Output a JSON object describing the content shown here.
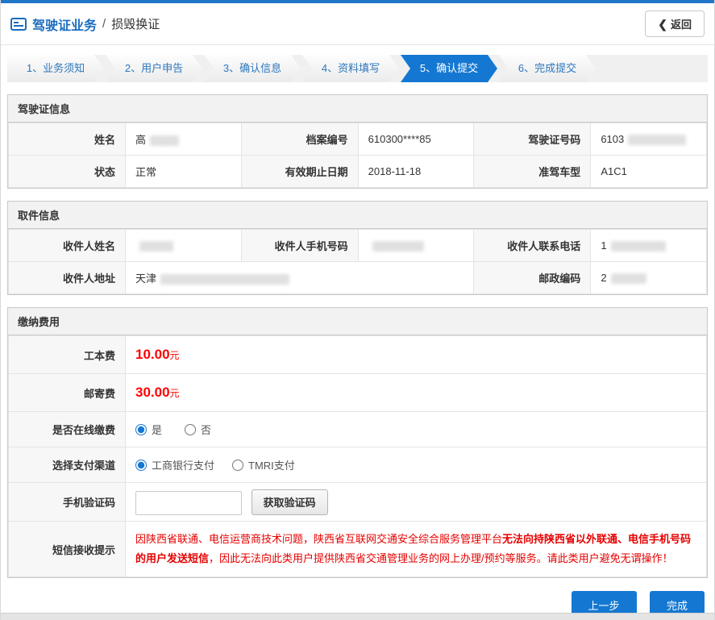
{
  "header": {
    "title": "驾驶证业务",
    "divider": "/",
    "subtitle": "损毁换证",
    "back_icon": "❮",
    "back_label": "返回"
  },
  "steps": {
    "s1": "1、业务须知",
    "s2": "2、用户申告",
    "s3": "3、确认信息",
    "s4": "4、资料填写",
    "s5": "5、确认提交",
    "s6": "6、完成提交"
  },
  "license": {
    "title": "驾驶证信息",
    "name_label": "姓名",
    "name_value": "高",
    "file_label": "档案编号",
    "file_value": "610300****85",
    "number_label": "驾驶证号码",
    "number_value": "6103",
    "status_label": "状态",
    "status_value": "正常",
    "expiry_label": "有效期止日期",
    "expiry_value": "2018-11-18",
    "vehicle_label": "准驾车型",
    "vehicle_value": "A1C1"
  },
  "pickup": {
    "title": "取件信息",
    "name_label": "收件人姓名",
    "mobile_label": "收件人手机号码",
    "phone_label": "收件人联系电话",
    "phone_value": "1",
    "address_label": "收件人地址",
    "address_value": "天津",
    "postal_label": "邮政编码",
    "postal_value": "2"
  },
  "fees": {
    "title": "缴纳费用",
    "production_label": "工本费",
    "production_value": "10.00",
    "production_unit": "元",
    "postage_label": "邮寄费",
    "postage_value": "30.00",
    "postage_unit": "元",
    "online_label": "是否在线缴费",
    "online_yes": "是",
    "online_no": "否",
    "channel_label": "选择支付渠道",
    "channel_icbc": "工商银行支付",
    "channel_tmri": "TMRI支付",
    "code_label": "手机验证码",
    "code_button": "获取验证码",
    "notice_label": "短信接收提示",
    "notice_part1": "因陕西省联通、电信运营商技术问题，陕西省互联网交通安全综合服务管理平台",
    "notice_part2": "无法向持陕西省以外联通、电信手机号码的用户发送短信",
    "notice_part3": "，因此无法向此类用户提供陕西省交通管理业务的网上办理/预约等服务。请此类用户避免无谓操作！"
  },
  "footer": {
    "prev_label": "上一步",
    "done_label": "完成"
  },
  "colors": {
    "accent_blue": "#1478d2",
    "price_red": "#ff0000",
    "notice_red": "#e60000"
  }
}
